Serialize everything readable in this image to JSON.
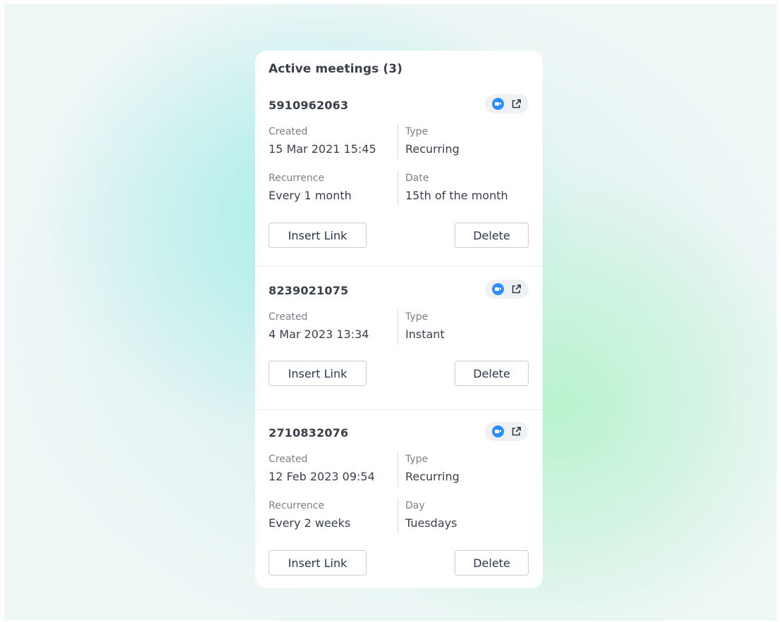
{
  "panel": {
    "title": "Active meetings (3)"
  },
  "icons": {
    "video": "zoom-video-icon",
    "open": "external-link-icon"
  },
  "colors": {
    "accent": "#2d8cff",
    "button_text": "#27384f"
  },
  "meetings": [
    {
      "id": "5910962063",
      "fields": [
        {
          "label": "Created",
          "value": "15 Mar 2021 15:45"
        },
        {
          "label": "Type",
          "value": "Recurring"
        },
        {
          "label": "Recurrence",
          "value": "Every 1 month"
        },
        {
          "label": "Date",
          "value": "15th of the month"
        }
      ],
      "insert_label": "Insert Link",
      "delete_label": "Delete"
    },
    {
      "id": "8239021075",
      "fields": [
        {
          "label": "Created",
          "value": "4 Mar 2023 13:34"
        },
        {
          "label": "Type",
          "value": "Instant"
        }
      ],
      "insert_label": "Insert Link",
      "delete_label": "Delete"
    },
    {
      "id": "2710832076",
      "fields": [
        {
          "label": "Created",
          "value": "12 Feb 2023 09:54"
        },
        {
          "label": "Type",
          "value": "Recurring"
        },
        {
          "label": "Recurrence",
          "value": "Every 2 weeks"
        },
        {
          "label": "Day",
          "value": "Tuesdays"
        }
      ],
      "insert_label": "Insert Link",
      "delete_label": "Delete"
    }
  ]
}
